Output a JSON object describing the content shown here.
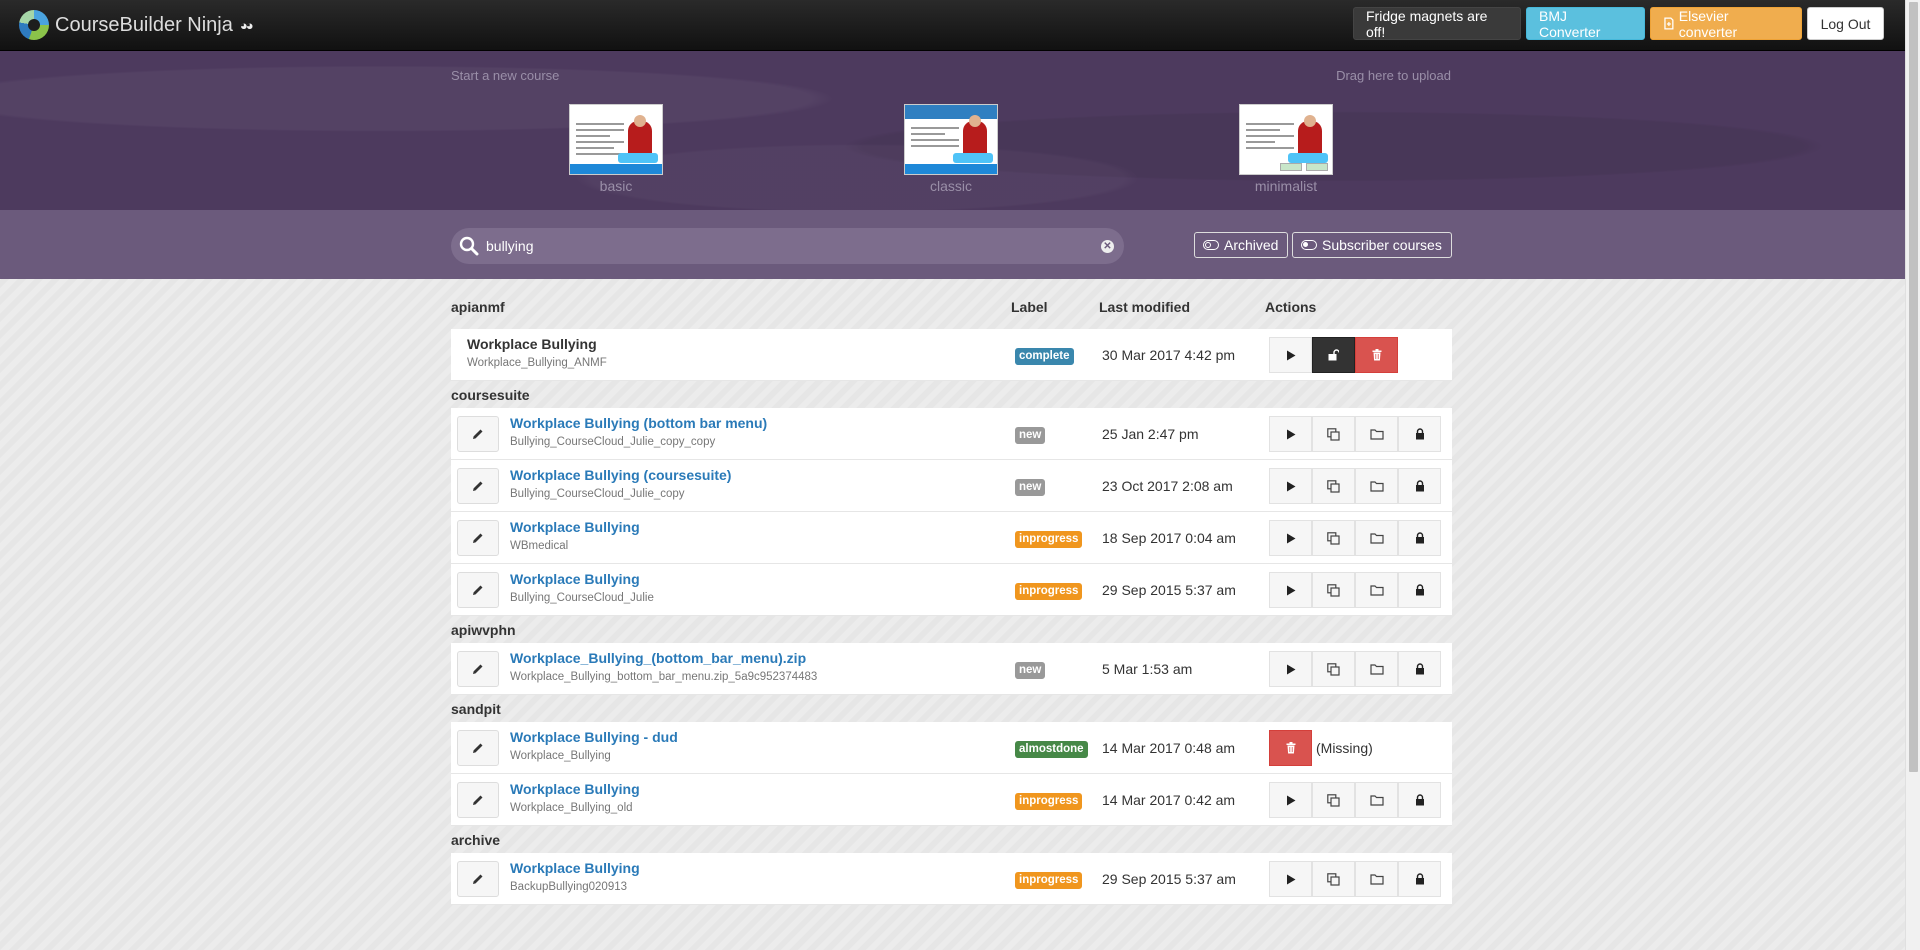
{
  "navbar": {
    "brand": "CourseBuilder Ninja",
    "brand_eyes": "◕◕",
    "magnets_label": "Fridge magnets are off!",
    "bmj_label": "BMJ Converter",
    "elsevier_label": "Elsevier converter",
    "logout_label": "Log Out"
  },
  "hero": {
    "start_label": "Start a new course",
    "upload_label": "Drag here to upload",
    "templates": [
      {
        "label": "basic"
      },
      {
        "label": "classic"
      },
      {
        "label": "minimalist"
      }
    ]
  },
  "search": {
    "value": "bullying",
    "archived_label": "Archived",
    "subscriber_label": "Subscriber courses"
  },
  "table": {
    "headers": {
      "owner": "apianmf",
      "label": "Label",
      "modified": "Last modified",
      "actions": "Actions"
    }
  },
  "groups": [
    {
      "title": "apianmf",
      "rows": [
        {
          "title": "Workplace Bullying",
          "sub": "Workplace_Bullying_ANMF",
          "badge": "complete",
          "modified": "30 Mar 2017 4:42 pm"
        }
      ]
    },
    {
      "title": "coursesuite",
      "rows": [
        {
          "title": "Workplace Bullying (bottom bar menu)",
          "sub": "Bullying_CourseCloud_Julie_copy_copy",
          "badge": "new",
          "modified": "25 Jan 2:47 pm"
        },
        {
          "title": "Workplace Bullying (coursesuite)",
          "sub": "Bullying_CourseCloud_Julie_copy",
          "badge": "new",
          "modified": "23 Oct 2017 2:08 am"
        },
        {
          "title": "Workplace Bullying",
          "sub": "WBmedical",
          "badge": "inprogress",
          "modified": "18 Sep 2017 0:04 am"
        },
        {
          "title": "Workplace Bullying",
          "sub": "Bullying_CourseCloud_Julie",
          "badge": "inprogress",
          "modified": "29 Sep 2015 5:37 am"
        }
      ]
    },
    {
      "title": "apiwvphn",
      "rows": [
        {
          "title": "Workplace_Bullying_(bottom_bar_menu).zip",
          "sub": "Workplace_Bullying_bottom_bar_menu.zip_5a9c952374483",
          "badge": "new",
          "modified": "5 Mar 1:53 am"
        }
      ]
    },
    {
      "title": "sandpit",
      "rows": [
        {
          "title": "Workplace Bullying - dud",
          "sub": "Workplace_Bullying",
          "badge": "almostdone",
          "modified": "14 Mar 2017 0:48 am",
          "missing": "(Missing)"
        },
        {
          "title": "Workplace Bullying",
          "sub": "Workplace_Bullying_old",
          "badge": "inprogress",
          "modified": "14 Mar 2017 0:42 am"
        }
      ]
    },
    {
      "title": "archive",
      "rows": [
        {
          "title": "Workplace Bullying",
          "sub": "BackupBullying020913",
          "badge": "inprogress",
          "modified": "29 Sep 2015 5:37 am"
        }
      ]
    }
  ],
  "colors": {
    "navbar": "#1d1d1d",
    "hero": "#4d3a5e",
    "search_band": "#6b5a7c",
    "link": "#2a7ab8",
    "complete": "#3a87ad",
    "new": "#999999",
    "inprogress": "#f0961e",
    "almostdone": "#468847",
    "danger": "#d9534f"
  },
  "icons": {
    "edit": "pencil-icon",
    "play": "play-icon",
    "copy": "copy-icon",
    "folder": "folder-icon",
    "lock": "lock-icon",
    "unlock": "unlock-icon",
    "trash": "trash-icon",
    "search": "search-icon",
    "clear": "clear-icon"
  }
}
